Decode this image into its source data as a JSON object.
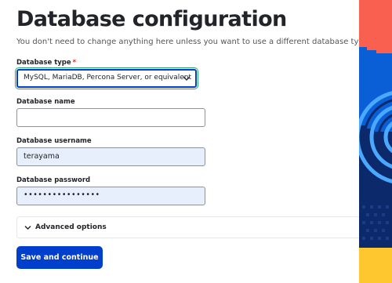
{
  "page": {
    "title": "Database configuration",
    "subtitle": "You don't need to change anything here unless you want to use a different database type."
  },
  "form": {
    "database_type": {
      "label": "Database type",
      "required_marker": "*",
      "selected_value": "MySQL, MariaDB, Percona Server, or equivalent"
    },
    "database_name": {
      "label": "Database name",
      "value": ""
    },
    "database_username": {
      "label": "Database username",
      "value": "terayama"
    },
    "database_password": {
      "label": "Database password",
      "masked_value": "••••••••••••••••"
    },
    "advanced_options": {
      "label": "Advanced options",
      "expanded": false
    },
    "submit_label": "Save and continue"
  },
  "colors": {
    "primary": "#003ecc",
    "required": "#dc2323",
    "focus_ring": "#26a769",
    "autofill_background": "#e8effc",
    "art_coral": "#f9604f",
    "art_blue": "#0a5fd6",
    "art_navy": "#0c2a6b",
    "art_yellow": "#fec72f"
  },
  "icons": {
    "select_chevron": "chevron-down-icon",
    "advanced_chevron": "chevron-down-icon"
  }
}
